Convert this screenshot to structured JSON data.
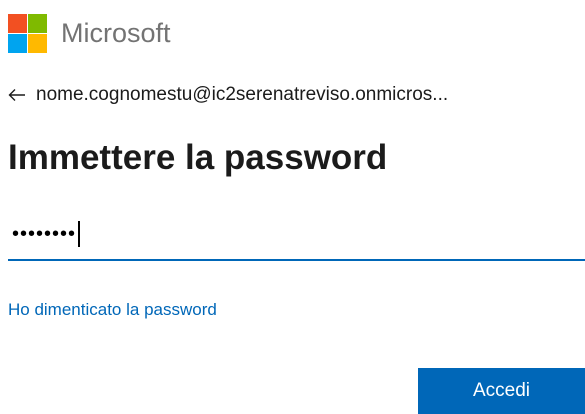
{
  "brand": {
    "name": "Microsoft",
    "logo_colors": {
      "top_left": "#f25022",
      "top_right": "#7fba00",
      "bottom_left": "#00a4ef",
      "bottom_right": "#ffb900"
    }
  },
  "identity": {
    "back_icon": "back-arrow-icon",
    "account": "nome.cognomestu@ic2serenatreviso.onmicros..."
  },
  "heading": "Immettere la password",
  "password_field": {
    "masked_value": "••••••••",
    "focused": true
  },
  "links": {
    "forgot_password": "Ho dimenticato la password"
  },
  "actions": {
    "sign_in": "Accedi"
  },
  "colors": {
    "accent": "#0067b8",
    "text": "#1b1b1b",
    "brand_text": "#737373"
  }
}
